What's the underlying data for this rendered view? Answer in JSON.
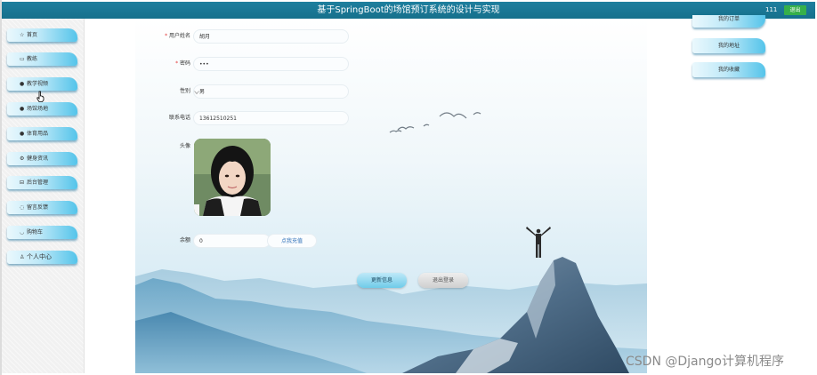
{
  "header": {
    "title": "基于SpringBoot的场馆预订系统的设计与实现",
    "user_id": "111",
    "logout_label": "退出"
  },
  "sidebar": {
    "items": [
      {
        "label": "首页",
        "icon": "star-icon",
        "glyph": "☆"
      },
      {
        "label": "教练",
        "icon": "document-icon",
        "glyph": "▭"
      },
      {
        "label": "教学视频",
        "icon": "video-icon",
        "glyph": "●"
      },
      {
        "label": "场馆场地",
        "icon": "venue-icon",
        "glyph": "●"
      },
      {
        "label": "体育用品",
        "icon": "goods-icon",
        "glyph": "●"
      },
      {
        "label": "健身资讯",
        "icon": "gear-icon",
        "glyph": "⚙"
      },
      {
        "label": "后台管理",
        "icon": "admin-icon",
        "glyph": "⊟"
      },
      {
        "label": "留言反馈",
        "icon": "message-icon",
        "glyph": "◌"
      },
      {
        "label": "购物车",
        "icon": "cart-icon",
        "glyph": "◡"
      },
      {
        "label": "个人中心",
        "icon": "user-icon",
        "glyph": "♙"
      }
    ]
  },
  "form": {
    "username": {
      "label": "用户姓名",
      "value": "胡月"
    },
    "password": {
      "label": "密码",
      "value": "•••"
    },
    "gender": {
      "label": "性别",
      "value": "男"
    },
    "phone": {
      "label": "联系电话",
      "value": "13612510251"
    },
    "avatar": {
      "label": "头像"
    },
    "balance": {
      "label": "余额",
      "value": "0",
      "recharge_label": "点我充值"
    },
    "update_label": "更新信息",
    "logout_label": "退出登录"
  },
  "right_nav": {
    "items": [
      {
        "label": "我的订单"
      },
      {
        "label": "我的地址"
      },
      {
        "label": "我的收藏"
      }
    ]
  },
  "watermark": "CSDN @Django计算机程序",
  "colors": {
    "topbar": "#1e7f9e",
    "accent": "#55c4ea",
    "logout_button": "#36b04a"
  }
}
